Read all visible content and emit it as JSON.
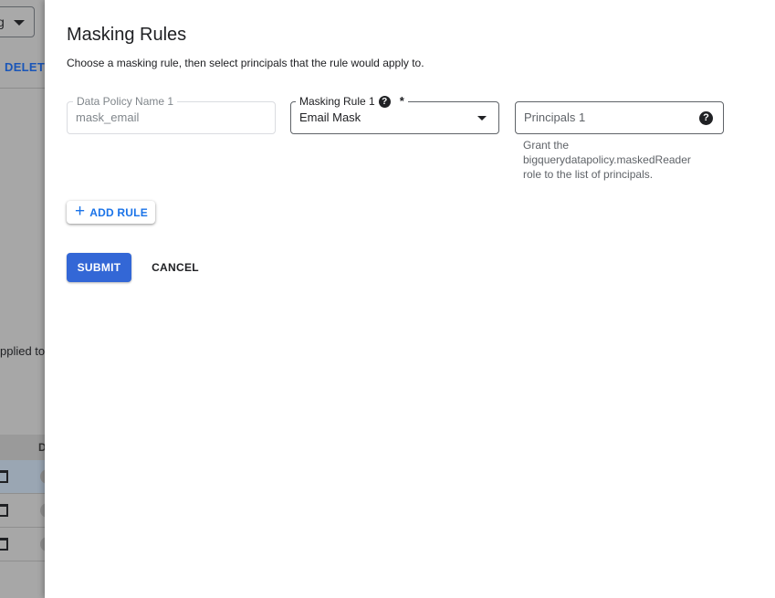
{
  "background": {
    "dropdown_fragment": "g",
    "delete_label": "DELETE",
    "applied_fragment": "pplied to",
    "table_header_fragment": "D"
  },
  "panel": {
    "title": "Masking Rules",
    "subtitle": "Choose a masking rule, then select principals that the rule would apply to.",
    "fields": {
      "data_policy_name": {
        "label": "Data Policy Name 1",
        "value": "mask_email"
      },
      "masking_rule": {
        "label": "Masking Rule 1",
        "required": "*",
        "value": "Email Mask",
        "help_icon": "help-icon"
      },
      "principals": {
        "placeholder": "Principals 1",
        "help_icon": "help-icon",
        "hint": "Grant the bigquerydatapolicy.maskedReader role to the list of principals."
      }
    },
    "buttons": {
      "add_rule": "ADD RULE",
      "submit": "SUBMIT",
      "cancel": "CANCEL"
    }
  },
  "colors": {
    "primary": "#3367d6",
    "link": "#1a73e8",
    "scrim": "#a7a7a7"
  }
}
